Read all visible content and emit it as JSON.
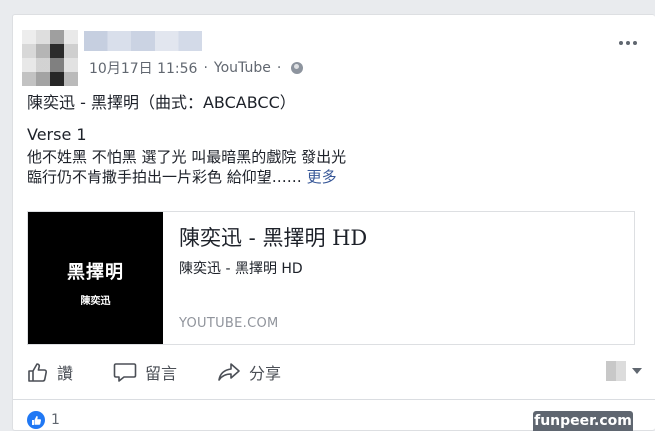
{
  "post": {
    "timestamp": "10月17日 11:56",
    "separator": "·",
    "source": "YouTube",
    "title_line": "陳奕迅 - 黑擇明（曲式：ABCABCC）",
    "verse_label": "Verse 1",
    "lyrics_line_1": "他不姓黑 不怕黑 選了光 叫最暗黑的戲院 發出光",
    "lyrics_line_2": "臨行仍不肯撒手拍出一片彩色 給仰望……",
    "see_more": "更多"
  },
  "link_preview": {
    "thumb_title": "黑擇明",
    "thumb_subtitle": "陳奕迅",
    "title": "陳奕迅 - 黑擇明 HD",
    "description": "陳奕迅 - 黑擇明 HD",
    "domain": "YOUTUBE.COM"
  },
  "actions": {
    "like": "讚",
    "comment": "留言",
    "share": "分享"
  },
  "reactions": {
    "count": "1"
  },
  "watermark": "funpeer.com",
  "icons": [
    "globe-icon",
    "more-icon",
    "like-icon",
    "comment-icon",
    "share-icon",
    "caret-down-icon",
    "like-badge-icon"
  ],
  "colors": {
    "link_blue": "#385898",
    "meta_gray": "#616770",
    "like_blue": "#2078f4"
  }
}
